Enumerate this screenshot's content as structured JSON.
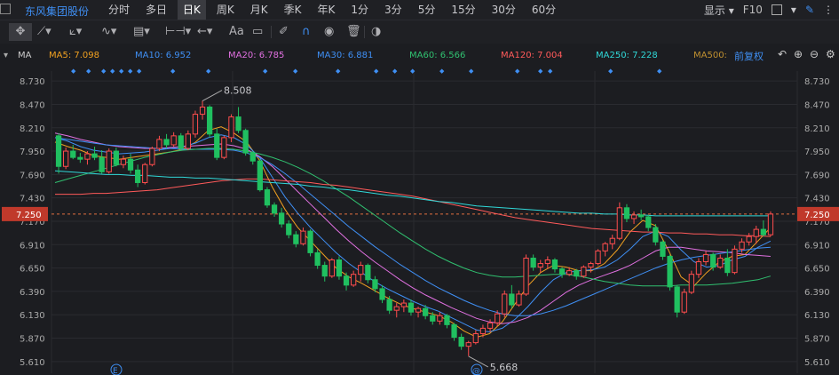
{
  "stock_name": "东风集团股份",
  "tabs": [
    {
      "label": "分时",
      "active": false
    },
    {
      "label": "多日",
      "active": false
    },
    {
      "label": "日K",
      "active": true
    },
    {
      "label": "周K",
      "active": false
    },
    {
      "label": "月K",
      "active": false
    },
    {
      "label": "季K",
      "active": false
    },
    {
      "label": "年K",
      "active": false
    },
    {
      "label": "1分",
      "active": false
    },
    {
      "label": "3分",
      "active": false
    },
    {
      "label": "5分",
      "active": false
    },
    {
      "label": "15分",
      "active": false
    },
    {
      "label": "30分",
      "active": false
    },
    {
      "label": "60分",
      "active": false
    }
  ],
  "right_tools": {
    "display_label": "显示",
    "f10_label": "F10"
  },
  "indicator_label": "MA",
  "ma_legend": [
    {
      "label": "MA5: 7.098",
      "color": "#f0a020"
    },
    {
      "label": "MA10: 6.952",
      "color": "#3f8ff4"
    },
    {
      "label": "MA20: 6.785",
      "color": "#e070e0"
    },
    {
      "label": "MA30: 6.881",
      "color": "#3f8ff4"
    },
    {
      "label": "MA60: 6.566",
      "color": "#30c070"
    },
    {
      "label": "MA120: 7.004",
      "color": "#ff5a5a"
    },
    {
      "label": "MA250: 7.228",
      "color": "#30d8d8"
    },
    {
      "label": "MA500:",
      "color": "#c09030"
    }
  ],
  "adjust_label": "前复权",
  "toolbar_text": "Aa",
  "chart_data": {
    "type": "candlestick",
    "y_ticks": [
      "8.730",
      "8.470",
      "8.210",
      "7.950",
      "7.690",
      "7.430",
      "7.170",
      "6.910",
      "6.650",
      "6.390",
      "6.130",
      "5.870",
      "5.610"
    ],
    "ylim": [
      5.48,
      8.84
    ],
    "current_price": "7.250",
    "annotations": [
      {
        "label": "8.508",
        "value": 8.508
      },
      {
        "label": "5.668",
        "value": 5.668
      }
    ],
    "up_color": "#ff4d4d",
    "down_color": "#20c060",
    "candles": [
      [
        8.12,
        8.15,
        7.7,
        7.78
      ],
      [
        7.78,
        7.99,
        7.75,
        7.95
      ],
      [
        7.95,
        8.02,
        7.86,
        7.88
      ],
      [
        7.88,
        7.93,
        7.82,
        7.86
      ],
      [
        7.86,
        7.95,
        7.8,
        7.92
      ],
      [
        7.92,
        8.0,
        7.85,
        7.88
      ],
      [
        7.88,
        7.96,
        7.7,
        7.72
      ],
      [
        7.72,
        7.98,
        7.7,
        7.95
      ],
      [
        7.95,
        7.99,
        7.78,
        7.8
      ],
      [
        7.8,
        7.9,
        7.76,
        7.86
      ],
      [
        7.86,
        7.92,
        7.7,
        7.74
      ],
      [
        7.74,
        7.8,
        7.55,
        7.6
      ],
      [
        7.6,
        7.82,
        7.58,
        7.8
      ],
      [
        7.8,
        8.0,
        7.78,
        7.98
      ],
      [
        7.98,
        8.12,
        7.95,
        8.08
      ],
      [
        8.08,
        8.14,
        7.98,
        8.02
      ],
      [
        8.02,
        8.16,
        8.0,
        8.12
      ],
      [
        8.12,
        8.15,
        7.96,
        7.98
      ],
      [
        7.98,
        8.18,
        7.96,
        8.14
      ],
      [
        8.14,
        8.4,
        8.1,
        8.36
      ],
      [
        8.36,
        8.51,
        8.3,
        8.44
      ],
      [
        8.44,
        8.46,
        8.1,
        8.14
      ],
      [
        8.14,
        8.2,
        7.85,
        7.88
      ],
      [
        7.88,
        8.12,
        7.86,
        8.1
      ],
      [
        8.1,
        8.36,
        8.05,
        8.33
      ],
      [
        8.33,
        8.44,
        8.15,
        8.18
      ],
      [
        8.18,
        8.2,
        7.9,
        7.93
      ],
      [
        7.93,
        7.95,
        7.8,
        7.84
      ],
      [
        7.84,
        7.86,
        7.5,
        7.52
      ],
      [
        7.52,
        7.55,
        7.32,
        7.35
      ],
      [
        7.35,
        7.38,
        7.22,
        7.26
      ],
      [
        7.26,
        7.32,
        7.1,
        7.14
      ],
      [
        7.14,
        7.18,
        6.98,
        7.02
      ],
      [
        7.02,
        7.06,
        6.88,
        6.92
      ],
      [
        6.92,
        7.1,
        6.9,
        7.06
      ],
      [
        7.06,
        7.08,
        6.78,
        6.82
      ],
      [
        6.82,
        6.86,
        6.64,
        6.68
      ],
      [
        6.68,
        6.72,
        6.5,
        6.56
      ],
      [
        6.56,
        6.76,
        6.54,
        6.74
      ],
      [
        6.74,
        6.78,
        6.52,
        6.56
      ],
      [
        6.56,
        6.6,
        6.4,
        6.46
      ],
      [
        6.46,
        6.62,
        6.44,
        6.58
      ],
      [
        6.58,
        6.72,
        6.5,
        6.68
      ],
      [
        6.68,
        6.7,
        6.48,
        6.52
      ],
      [
        6.52,
        6.56,
        6.38,
        6.42
      ],
      [
        6.42,
        6.46,
        6.26,
        6.3
      ],
      [
        6.3,
        6.34,
        6.14,
        6.18
      ],
      [
        6.18,
        6.26,
        6.1,
        6.22
      ],
      [
        6.22,
        6.3,
        6.16,
        6.26
      ],
      [
        6.26,
        6.3,
        6.12,
        6.16
      ],
      [
        6.16,
        6.22,
        6.1,
        6.2
      ],
      [
        6.2,
        6.24,
        6.08,
        6.12
      ],
      [
        6.12,
        6.16,
        6.02,
        6.06
      ],
      [
        6.06,
        6.16,
        6.02,
        6.12
      ],
      [
        6.12,
        6.14,
        5.98,
        6.02
      ],
      [
        6.02,
        6.04,
        5.84,
        5.88
      ],
      [
        5.88,
        5.92,
        5.74,
        5.78
      ],
      [
        5.78,
        5.84,
        5.67,
        5.82
      ],
      [
        5.82,
        5.96,
        5.8,
        5.92
      ],
      [
        5.92,
        6.02,
        5.88,
        5.98
      ],
      [
        5.98,
        6.08,
        5.94,
        6.04
      ],
      [
        6.04,
        6.18,
        6.0,
        6.14
      ],
      [
        6.14,
        6.4,
        6.1,
        6.36
      ],
      [
        6.36,
        6.46,
        6.2,
        6.24
      ],
      [
        6.24,
        6.4,
        6.22,
        6.36
      ],
      [
        6.36,
        6.8,
        6.34,
        6.76
      ],
      [
        6.76,
        6.8,
        6.62,
        6.66
      ],
      [
        6.66,
        6.74,
        6.6,
        6.7
      ],
      [
        6.7,
        6.78,
        6.64,
        6.74
      ],
      [
        6.74,
        6.76,
        6.6,
        6.64
      ],
      [
        6.64,
        6.66,
        6.54,
        6.58
      ],
      [
        6.58,
        6.66,
        6.56,
        6.62
      ],
      [
        6.62,
        6.64,
        6.52,
        6.56
      ],
      [
        6.56,
        6.68,
        6.54,
        6.66
      ],
      [
        6.66,
        6.72,
        6.6,
        6.7
      ],
      [
        6.7,
        6.86,
        6.68,
        6.84
      ],
      [
        6.84,
        6.94,
        6.78,
        6.92
      ],
      [
        6.92,
        7.02,
        6.86,
        6.98
      ],
      [
        6.98,
        7.38,
        6.96,
        7.32
      ],
      [
        7.32,
        7.36,
        7.16,
        7.2
      ],
      [
        7.2,
        7.28,
        7.14,
        7.24
      ],
      [
        7.24,
        7.3,
        7.18,
        7.22
      ],
      [
        7.22,
        7.24,
        7.06,
        7.1
      ],
      [
        7.1,
        7.14,
        6.9,
        6.94
      ],
      [
        6.94,
        6.96,
        6.74,
        6.78
      ],
      [
        6.78,
        6.8,
        6.4,
        6.44
      ],
      [
        6.44,
        6.46,
        6.1,
        6.16
      ],
      [
        6.16,
        6.42,
        6.14,
        6.38
      ],
      [
        6.38,
        6.62,
        6.36,
        6.58
      ],
      [
        6.58,
        6.76,
        6.54,
        6.72
      ],
      [
        6.72,
        6.84,
        6.68,
        6.8
      ],
      [
        6.8,
        6.82,
        6.62,
        6.66
      ],
      [
        6.66,
        6.8,
        6.64,
        6.76
      ],
      [
        6.76,
        6.86,
        6.56,
        6.6
      ],
      [
        6.6,
        6.9,
        6.58,
        6.86
      ],
      [
        6.86,
        6.98,
        6.82,
        6.94
      ],
      [
        6.94,
        7.04,
        6.9,
        7.0
      ],
      [
        7.0,
        7.12,
        6.92,
        7.08
      ],
      [
        7.08,
        7.18,
        7.0,
        7.02
      ],
      [
        7.02,
        7.28,
        7.0,
        7.25
      ]
    ],
    "ma_series": [
      {
        "label": "MA5",
        "color": "#f0a020",
        "values": [
          8.05,
          8.0,
          7.96,
          7.9,
          7.88,
          7.86,
          7.88,
          7.9,
          7.92,
          7.94,
          7.97,
          8.05,
          8.18,
          8.22,
          8.15,
          8.05,
          7.85,
          7.55,
          7.3,
          7.1,
          6.95,
          6.8,
          6.65,
          6.55,
          6.48,
          6.4,
          6.32,
          6.25,
          6.2,
          6.16,
          6.12,
          6.05,
          5.95,
          5.88,
          5.92,
          6.05,
          6.25,
          6.45,
          6.6,
          6.68,
          6.66,
          6.62,
          6.62,
          6.7,
          6.85,
          7.05,
          7.18,
          7.12,
          6.85,
          6.55,
          6.45,
          6.6,
          6.72,
          6.78,
          6.8,
          6.95,
          7.1
        ]
      },
      {
        "label": "MA10",
        "color": "#3f8ff4",
        "values": [
          8.1,
          8.06,
          8.0,
          7.96,
          7.94,
          7.92,
          7.93,
          7.94,
          7.96,
          7.98,
          8.0,
          8.04,
          8.1,
          8.13,
          8.1,
          8.02,
          7.88,
          7.66,
          7.44,
          7.26,
          7.1,
          6.96,
          6.82,
          6.7,
          6.6,
          6.5,
          6.42,
          6.35,
          6.28,
          6.22,
          6.17,
          6.1,
          6.03,
          5.96,
          5.94,
          5.98,
          6.08,
          6.22,
          6.38,
          6.52,
          6.6,
          6.62,
          6.63,
          6.66,
          6.74,
          6.86,
          7.0,
          7.06,
          7.0,
          6.85,
          6.72,
          6.66,
          6.68,
          6.74,
          6.78,
          6.88,
          6.95
        ]
      },
      {
        "label": "MA20",
        "color": "#e070e0",
        "values": [
          8.15,
          8.12,
          8.08,
          8.05,
          8.02,
          8.0,
          7.99,
          7.98,
          7.98,
          7.99,
          8.0,
          8.01,
          8.02,
          8.03,
          8.01,
          7.97,
          7.89,
          7.78,
          7.64,
          7.5,
          7.36,
          7.22,
          7.08,
          6.95,
          6.83,
          6.72,
          6.62,
          6.52,
          6.43,
          6.35,
          6.28,
          6.21,
          6.15,
          6.09,
          6.05,
          6.03,
          6.05,
          6.1,
          6.18,
          6.28,
          6.38,
          6.46,
          6.52,
          6.57,
          6.62,
          6.68,
          6.76,
          6.84,
          6.88,
          6.88,
          6.86,
          6.84,
          6.83,
          6.82,
          6.8,
          6.79,
          6.78
        ]
      },
      {
        "label": "MA30",
        "color": "#3f8ff4",
        "values": [
          8.1,
          8.08,
          8.06,
          8.04,
          8.02,
          8.01,
          8.0,
          7.99,
          7.98,
          7.98,
          7.97,
          7.97,
          7.97,
          7.97,
          7.96,
          7.93,
          7.88,
          7.8,
          7.7,
          7.59,
          7.47,
          7.35,
          7.23,
          7.11,
          7.0,
          6.89,
          6.79,
          6.69,
          6.6,
          6.51,
          6.43,
          6.36,
          6.29,
          6.23,
          6.18,
          6.14,
          6.12,
          6.12,
          6.14,
          6.18,
          6.23,
          6.29,
          6.35,
          6.41,
          6.47,
          6.53,
          6.59,
          6.65,
          6.7,
          6.74,
          6.77,
          6.79,
          6.81,
          6.83,
          6.85,
          6.87,
          6.88
        ]
      },
      {
        "label": "MA60",
        "color": "#30c070",
        "values": [
          7.6,
          7.64,
          7.68,
          7.72,
          7.76,
          7.8,
          7.84,
          7.88,
          7.91,
          7.94,
          7.96,
          7.97,
          7.98,
          7.98,
          7.97,
          7.95,
          7.92,
          7.88,
          7.83,
          7.77,
          7.7,
          7.62,
          7.53,
          7.44,
          7.34,
          7.24,
          7.14,
          7.04,
          6.95,
          6.86,
          6.78,
          6.71,
          6.65,
          6.6,
          6.57,
          6.55,
          6.55,
          6.56,
          6.57,
          6.58,
          6.58,
          6.56,
          6.53,
          6.5,
          6.48,
          6.46,
          6.45,
          6.45,
          6.45,
          6.46,
          6.46,
          6.46,
          6.47,
          6.48,
          6.5,
          6.52,
          6.56
        ]
      },
      {
        "label": "MA120",
        "color": "#ff5a5a",
        "values": [
          7.47,
          7.47,
          7.47,
          7.48,
          7.48,
          7.49,
          7.5,
          7.51,
          7.52,
          7.54,
          7.56,
          7.58,
          7.6,
          7.62,
          7.63,
          7.64,
          7.64,
          7.63,
          7.62,
          7.61,
          7.6,
          7.58,
          7.57,
          7.55,
          7.53,
          7.51,
          7.49,
          7.47,
          7.45,
          7.42,
          7.39,
          7.36,
          7.33,
          7.3,
          7.27,
          7.24,
          7.21,
          7.19,
          7.17,
          7.15,
          7.13,
          7.11,
          7.09,
          7.08,
          7.07,
          7.06,
          7.05,
          7.05,
          7.04,
          7.04,
          7.03,
          7.03,
          7.02,
          7.02,
          7.01,
          7.01,
          7.0
        ]
      },
      {
        "label": "MA250",
        "color": "#30d8d8",
        "values": [
          7.73,
          7.72,
          7.71,
          7.7,
          7.69,
          7.69,
          7.68,
          7.68,
          7.67,
          7.66,
          7.66,
          7.65,
          7.65,
          7.64,
          7.63,
          7.62,
          7.61,
          7.6,
          7.59,
          7.58,
          7.56,
          7.55,
          7.53,
          7.52,
          7.5,
          7.48,
          7.46,
          7.45,
          7.43,
          7.41,
          7.39,
          7.38,
          7.36,
          7.34,
          7.33,
          7.32,
          7.31,
          7.3,
          7.29,
          7.28,
          7.27,
          7.26,
          7.26,
          7.25,
          7.25,
          7.24,
          7.24,
          7.23,
          7.23,
          7.23,
          7.23,
          7.23,
          7.23,
          7.23,
          7.23,
          7.23,
          7.23
        ]
      }
    ],
    "event_markers": [
      "E",
      "@"
    ]
  }
}
